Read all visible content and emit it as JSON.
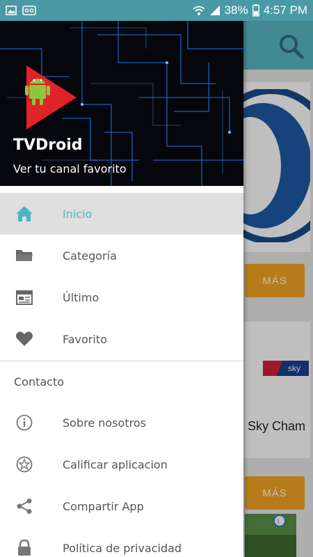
{
  "status_bar": {
    "battery_percent": "38%",
    "time": "4:57 PM"
  },
  "background": {
    "buttons": [
      {
        "label": "MÁS"
      },
      {
        "label": "MÁS"
      }
    ],
    "card_title": "Sky Cham"
  },
  "drawer": {
    "app_name": "TVDroid",
    "tagline": "Ver tu canal favorito",
    "menu_items": [
      {
        "label": "Inicio",
        "icon": "home-icon",
        "active": true
      },
      {
        "label": "Categoría",
        "icon": "folder-icon",
        "active": false
      },
      {
        "label": "Último",
        "icon": "calendar-icon",
        "active": false
      },
      {
        "label": "Favorito",
        "icon": "heart-icon",
        "active": false
      }
    ],
    "section_title": "Contacto",
    "contact_items": [
      {
        "label": "Sobre nosotros",
        "icon": "info-icon"
      },
      {
        "label": "Calificar aplicacion",
        "icon": "star-icon"
      },
      {
        "label": "Compartir App",
        "icon": "share-icon"
      },
      {
        "label": "Política de privacidad",
        "icon": "lock-icon"
      }
    ]
  },
  "colors": {
    "accent": "#4fb3c4",
    "toolbar": "#5ab7c3",
    "status_bar": "#4a9aa5",
    "button_orange": "#f4a425"
  }
}
